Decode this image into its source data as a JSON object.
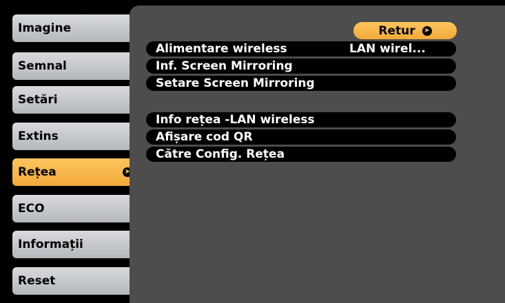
{
  "tabs": [
    {
      "label": "Imagine"
    },
    {
      "label": "Semnal"
    },
    {
      "label": "Setări"
    },
    {
      "label": "Extins"
    },
    {
      "label": "Rețea"
    },
    {
      "label": "ECO"
    },
    {
      "label": "Informații"
    },
    {
      "label": "Reset"
    }
  ],
  "selected_tab": "Rețea",
  "panel": {
    "return_label": "Retur",
    "items": [
      {
        "label": "Alimentare wireless",
        "value": "LAN wirel..."
      },
      {
        "label": "Inf. Screen Mirroring"
      },
      {
        "label": "Setare Screen Mirroring"
      },
      {
        "label": "Info rețea -LAN wireless"
      },
      {
        "label": "Afișare cod QR"
      },
      {
        "label": "Către Config. Rețea"
      }
    ]
  },
  "icons": {
    "enter": "enter-arrow-icon"
  },
  "colors": {
    "background": "#000000",
    "panel": "#4d4d4d",
    "tab": "#c8cacd",
    "selected_tab": "#f6b646"
  }
}
